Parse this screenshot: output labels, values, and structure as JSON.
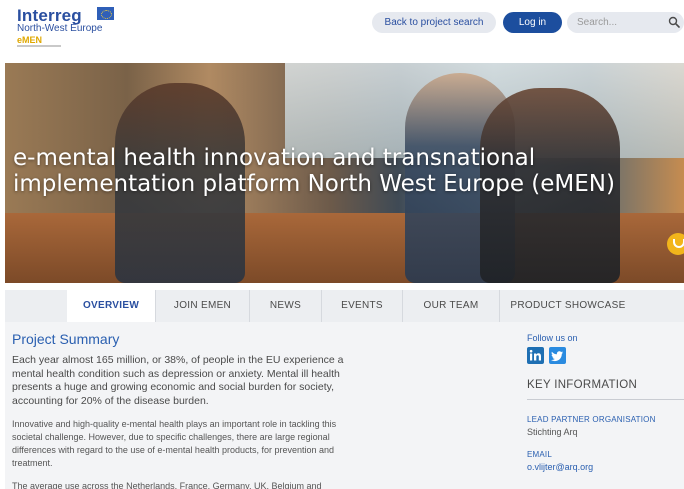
{
  "header": {
    "logo": {
      "brand": "Interreg",
      "region": "North-West Europe",
      "project": "eMEN"
    },
    "back_label": "Back to project search",
    "login_label": "Log in",
    "search_placeholder": "Search...",
    "search_icon": "search-icon"
  },
  "hero": {
    "title_line1": "e-mental health innovation and transnational",
    "title_line2": "implementation platform North West Europe (eMEN)"
  },
  "tabs": [
    {
      "label": "OVERVIEW",
      "active": true
    },
    {
      "label": "JOIN EMEN",
      "active": false
    },
    {
      "label": "NEWS",
      "active": false
    },
    {
      "label": "EVENTS",
      "active": false
    },
    {
      "label": "OUR TEAM",
      "active": false
    },
    {
      "label": "PRODUCT SHOWCASE",
      "active": false
    }
  ],
  "summary": {
    "title": "Project Summary",
    "para1": "Each year almost 165 million, or 38%, of people in the EU experience a mental health condition such as depression or anxiety. Mental ill health presents a huge and growing economic and social burden for society, accounting for 20% of the disease burden.",
    "para2": "Innovative and high-quality e-mental health plays an important role in tackling this societal challenge. However, due to specific challenges, there are large regional differences with regard to the use of e-mental health products, for prevention and treatment.",
    "para3": "The average use across the Netherlands, France, Germany, UK, Belgium and"
  },
  "sidebar": {
    "follow_label": "Follow us on",
    "key_info_title": "KEY INFORMATION",
    "lead_label": "LEAD PARTNER ORGANISATION",
    "lead_value": "Stichting Arq",
    "email_label": "EMAIL",
    "email_value": "o.vlijter@arq.org"
  },
  "colors": {
    "brand_blue": "#2a4fa0",
    "login_bg": "#1c4e9e",
    "accent_yellow": "#f2b51b"
  }
}
